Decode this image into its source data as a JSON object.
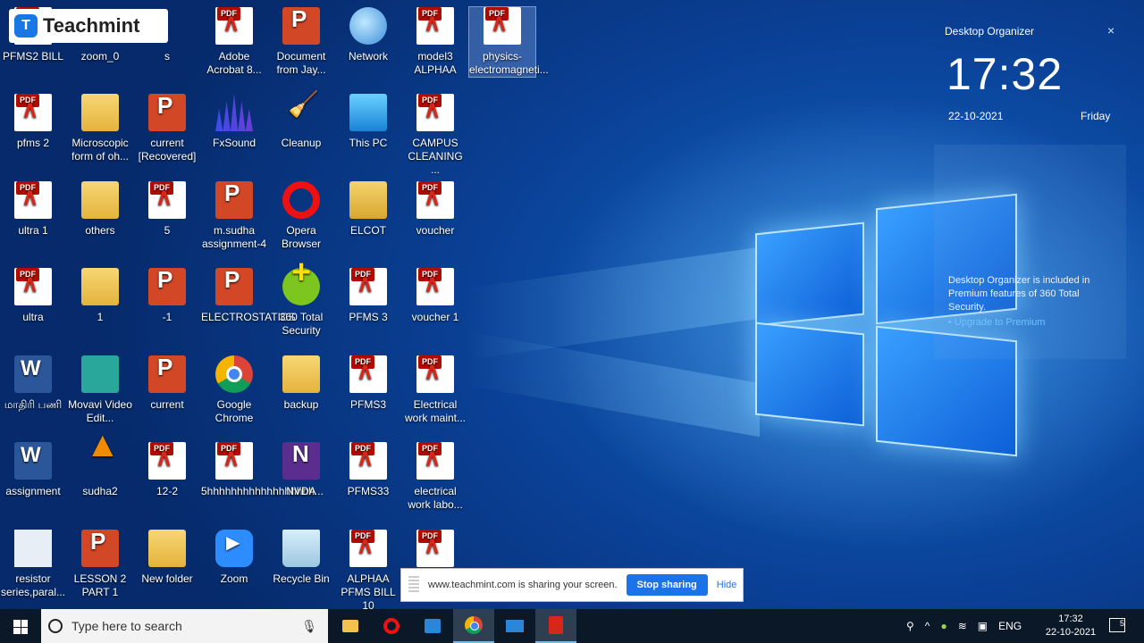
{
  "overlay": {
    "brand": "Teachmint"
  },
  "desktop": {
    "icons": [
      {
        "label": "PFMS2 BILL",
        "type": "pdf"
      },
      {
        "label": "zoom_0",
        "type": "file"
      },
      {
        "label": "s",
        "type": "file"
      },
      {
        "label": "Adobe Acrobat 8...",
        "type": "pdf"
      },
      {
        "label": "Document from Jay...",
        "type": "ppt"
      },
      {
        "label": "Network",
        "type": "net"
      },
      {
        "label": "model3 ALPHAA",
        "type": "pdf"
      },
      {
        "label": "physics-electromagneti...",
        "type": "pdf"
      },
      {
        "label": "pfms 2",
        "type": "pdf"
      },
      {
        "label": "Microscopic form of oh...",
        "type": "folder"
      },
      {
        "label": "current [Recovered]",
        "type": "ppt"
      },
      {
        "label": "FxSound",
        "type": "fx"
      },
      {
        "label": "Cleanup",
        "type": "broom"
      },
      {
        "label": "This PC",
        "type": "pc"
      },
      {
        "label": "CAMPUS CLEANING ...",
        "type": "pdf"
      },
      {
        "label": "ultra 1",
        "type": "pdf"
      },
      {
        "label": "others",
        "type": "folder"
      },
      {
        "label": "5",
        "type": "pdf"
      },
      {
        "label": "m.sudha assignment-4",
        "type": "ppt"
      },
      {
        "label": "Opera Browser",
        "type": "opera"
      },
      {
        "label": "ELCOT",
        "type": "elcot"
      },
      {
        "label": "voucher",
        "type": "pdf"
      },
      {
        "label": "ultra",
        "type": "pdf"
      },
      {
        "label": "1",
        "type": "folder"
      },
      {
        "label": "-1",
        "type": "ppt"
      },
      {
        "label": "ELECTROSTATICS",
        "type": "ppt"
      },
      {
        "label": "360 Total Security",
        "type": "total360"
      },
      {
        "label": "PFMS 3",
        "type": "pdf"
      },
      {
        "label": "voucher 1",
        "type": "pdf"
      },
      {
        "label": "மாதிரி பணி",
        "type": "word"
      },
      {
        "label": "Movavi Video Edit...",
        "type": "movavi"
      },
      {
        "label": "current",
        "type": "ppt"
      },
      {
        "label": "Google Chrome",
        "type": "chrome"
      },
      {
        "label": "backup",
        "type": "folder"
      },
      {
        "label": "PFMS3",
        "type": "pdf"
      },
      {
        "label": "Electrical work maint...",
        "type": "pdf"
      },
      {
        "label": "assignment",
        "type": "word"
      },
      {
        "label": "sudha2",
        "type": "vlc"
      },
      {
        "label": "12-2",
        "type": "pdf"
      },
      {
        "label": "5hhhhhhhhhhhhhhhhhh...",
        "type": "pdf"
      },
      {
        "label": "NVDA",
        "type": "nvda"
      },
      {
        "label": "PFMS33",
        "type": "pdf"
      },
      {
        "label": "electrical work labo...",
        "type": "pdf"
      },
      {
        "label": "resistor series,paral...",
        "type": "resistor"
      },
      {
        "label": "LESSON 2 PART 1",
        "type": "ppt"
      },
      {
        "label": "New folder",
        "type": "folder"
      },
      {
        "label": "Zoom",
        "type": "zoomi"
      },
      {
        "label": "Recycle Bin",
        "type": "bin"
      },
      {
        "label": "ALPHAA PFMS BILL 10",
        "type": "pdf"
      },
      {
        "label": "",
        "type": "pdf"
      }
    ]
  },
  "organizer": {
    "title": "Desktop Organizer",
    "close": "×",
    "time": "17:32",
    "date": "22-10-2021",
    "day": "Friday",
    "note": "Desktop Organizer is included in Premium features of 360 Total Security.",
    "link": "• Upgrade to Premium"
  },
  "sharebar": {
    "text": "www.teachmint.com is sharing your screen.",
    "stop": "Stop sharing",
    "hide": "Hide"
  },
  "taskbar": {
    "search_placeholder": "Type here to search",
    "lang": "ENG",
    "time": "17:32",
    "date": "22-10-2021",
    "notif_count": "5"
  }
}
